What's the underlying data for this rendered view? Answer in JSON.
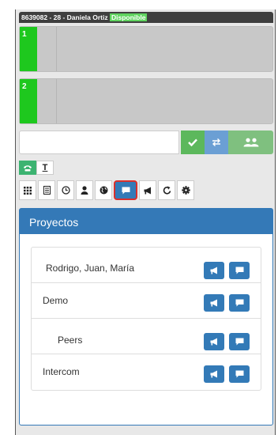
{
  "agent": {
    "info": "8639082 - 28 - Daniela Ortiz",
    "status": "Disponible"
  },
  "lines": [
    {
      "number": "1"
    },
    {
      "number": "2"
    }
  ],
  "dialer": {
    "input_value": "",
    "icons": [
      "check-icon",
      "transfer-icon",
      "conference-icon"
    ]
  },
  "tabs": [
    {
      "icon": "phone-icon",
      "active": true
    },
    {
      "label": "T",
      "active": false
    }
  ],
  "toolbar": [
    "keypad-icon",
    "contacts-list-icon",
    "clock-icon",
    "user-icon",
    "globe-icon",
    "chat-icon",
    "megaphone-icon",
    "share-icon",
    "gear-icon"
  ],
  "colors": {
    "primary": "#337ab7",
    "success": "#5cb85c",
    "line_active": "#1ec81e",
    "highlight": "#d9302c"
  },
  "panel": {
    "title": "Proyectos",
    "items": [
      {
        "name": "Rodrigo, Juan, María"
      },
      {
        "name": "Demo"
      },
      {
        "name": "Peers"
      },
      {
        "name": "Intercom"
      }
    ]
  }
}
